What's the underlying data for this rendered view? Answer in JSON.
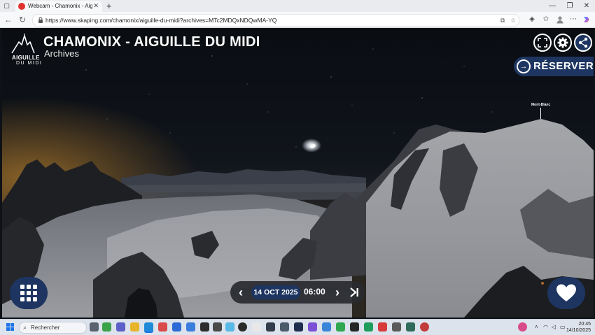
{
  "browser": {
    "tab_title": "Webcam - Chamonix - Aiguille du Midi",
    "tab_close": "✕",
    "new_tab": "+",
    "url": "https://www.skaping.com/chamonix/aiguille-du-midi?archives=MTc2MDQxNDQwMA-YQ",
    "window_controls": {
      "minimize": "—",
      "restore": "❐",
      "close": "✕"
    }
  },
  "logo": {
    "line1": "AIGUILLE",
    "line2": "DU MIDI"
  },
  "webcam": {
    "title": "CHAMONIX - AIGUILLE DU MIDI",
    "subtitle": "Archives",
    "reserve_label": "RÉSERVER",
    "poi_label": "Mont-Blanc"
  },
  "archive_nav": {
    "date": "14 OCT 2025",
    "time": "06:00",
    "prev": "‹",
    "next": "›"
  },
  "taskbar": {
    "search_placeholder": "Rechercher",
    "clock_time": "20:45",
    "clock_date": "14/10/2025"
  },
  "colors": {
    "accent_navy": "#1d3560",
    "tab_favicon": "#e0332f"
  }
}
